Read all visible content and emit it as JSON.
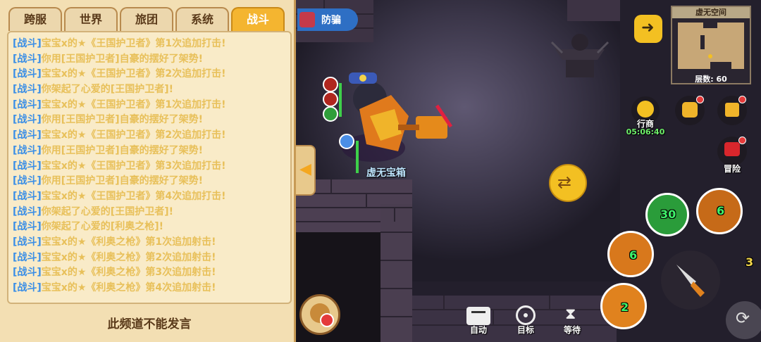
{
  "tabs": [
    {
      "label": "跨服"
    },
    {
      "label": "世界"
    },
    {
      "label": "旅团"
    },
    {
      "label": "系统"
    },
    {
      "label": "战斗",
      "active": true
    }
  ],
  "log": [
    {
      "tag": "[战斗]",
      "text": "宝宝x的★《王国护卫者》第1次追加打击!"
    },
    {
      "tag": "[战斗]",
      "text": "你用[王国护卫者]自豪的摆好了架势!"
    },
    {
      "tag": "[战斗]",
      "text": "宝宝x的★《王国护卫者》第2次追加打击!"
    },
    {
      "tag": "[战斗]",
      "text": "你架起了心爱的[王国护卫者]!"
    },
    {
      "tag": "[战斗]",
      "text": "宝宝x的★《王国护卫者》第1次追加打击!"
    },
    {
      "tag": "[战斗]",
      "text": "你用[王国护卫者]自豪的摆好了架势!"
    },
    {
      "tag": "[战斗]",
      "text": "宝宝x的★《王国护卫者》第2次追加打击!"
    },
    {
      "tag": "[战斗]",
      "text": "你用[王国护卫者]自豪的摆好了架势!"
    },
    {
      "tag": "[战斗]",
      "text": "宝宝x的★《王国护卫者》第3次追加打击!"
    },
    {
      "tag": "[战斗]",
      "text": "你用[王国护卫者]自豪的摆好了架势!"
    },
    {
      "tag": "[战斗]",
      "text": "宝宝x的★《王国护卫者》第4次追加打击!"
    },
    {
      "tag": "[战斗]",
      "text": "你架起了心爱的[王国护卫者]!"
    },
    {
      "tag": "[战斗]",
      "text": "你架起了心爱的[利奥之枪]!"
    },
    {
      "tag": "[战斗]",
      "text": "宝宝x的★《利奥之枪》第1次追加射击!"
    },
    {
      "tag": "[战斗]",
      "text": "宝宝x的★《利奥之枪》第2次追加射击!"
    },
    {
      "tag": "[战斗]",
      "text": "宝宝x的★《利奥之枪》第3次追加射击!"
    },
    {
      "tag": "[战斗]",
      "text": "宝宝x的★《利奥之枪》第4次追加射击!"
    }
  ],
  "footer": "此频道不能发言",
  "anti_fraud": "防骗",
  "chest_label": "虚无宝箱",
  "minimap": {
    "title": "虚无空间",
    "floor": "层数: 60"
  },
  "merchant": {
    "label": "行商",
    "timer": "05:06:40"
  },
  "adventure": "冒险",
  "bottom": {
    "auto": "自动",
    "target": "目标",
    "wait": "等待"
  },
  "skills": {
    "s1": "30",
    "s2": "6",
    "s3": "6",
    "s4": "2",
    "side": "3"
  },
  "colors": {
    "tab_active": "#f4b530",
    "log_tag": "#3a8ee6",
    "log_text": "#e8c05a"
  }
}
